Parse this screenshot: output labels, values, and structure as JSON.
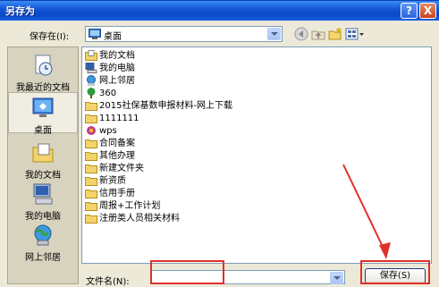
{
  "window": {
    "title": "另存为"
  },
  "title_buttons": {
    "help": "?",
    "close": "X"
  },
  "location": {
    "label": "保存在(I):",
    "value": "桌面"
  },
  "places": [
    {
      "label": "我最近的文档",
      "icon": "recent-documents-icon"
    },
    {
      "label": "桌面",
      "icon": "desktop-icon"
    },
    {
      "label": "我的文档",
      "icon": "my-documents-icon"
    },
    {
      "label": "我的电脑",
      "icon": "my-computer-icon"
    },
    {
      "label": "网上邻居",
      "icon": "network-places-icon"
    }
  ],
  "files": [
    {
      "name": "我的文档",
      "icon": "my-documents-icon"
    },
    {
      "name": "我的电脑",
      "icon": "my-computer-icon"
    },
    {
      "name": "网上邻居",
      "icon": "network-places-icon"
    },
    {
      "name": "360",
      "icon": "tree-icon"
    },
    {
      "name": "2015社保基数申报材料-网上下载",
      "icon": "folder-icon"
    },
    {
      "name": "1111111",
      "icon": "folder-icon"
    },
    {
      "name": "wps",
      "icon": "app-icon"
    },
    {
      "name": "合同备案",
      "icon": "folder-icon"
    },
    {
      "name": "其他办理",
      "icon": "folder-icon"
    },
    {
      "name": "新建文件夹",
      "icon": "folder-icon"
    },
    {
      "name": "新资质",
      "icon": "folder-icon"
    },
    {
      "name": "信用手册",
      "icon": "folder-icon"
    },
    {
      "name": "周报+工作计划",
      "icon": "folder-icon"
    },
    {
      "name": "注册类人员相关材料",
      "icon": "folder-icon"
    }
  ],
  "filename": {
    "label": "文件名(N):",
    "value": ""
  },
  "save_button": {
    "label": "保存(S)"
  },
  "colors": {
    "annotation": "#e0302a",
    "titlebar": "#0a49c8"
  }
}
